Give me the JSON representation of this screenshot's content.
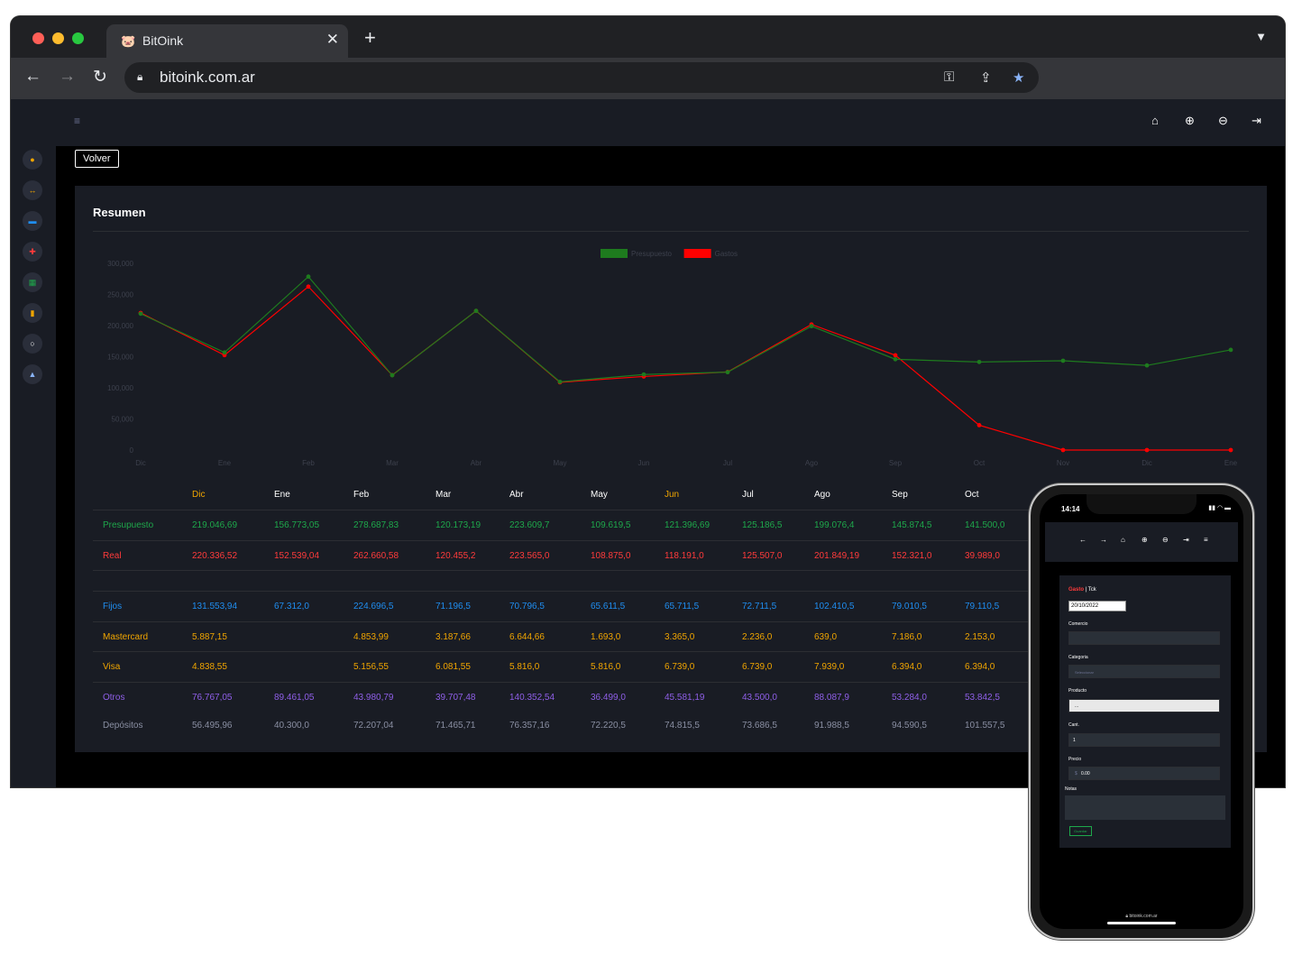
{
  "browser": {
    "tab_title": "BitOink",
    "url": "bitoink.com.ar"
  },
  "app": {
    "back_label": "Volver",
    "card_title": "Resumen"
  },
  "chart_data": {
    "type": "line",
    "categories": [
      "Dic",
      "Ene",
      "Feb",
      "Mar",
      "Abr",
      "May",
      "Jun",
      "Jul",
      "Ago",
      "Sep",
      "Oct",
      "Nov",
      "Dic",
      "Ene"
    ],
    "series": [
      {
        "name": "Presupuesto",
        "color": "#1e7b1e",
        "values": [
          219046.69,
          156773.05,
          278687.83,
          120173.19,
          223609.7,
          109619.5,
          121396.69,
          125186.5,
          199076.4,
          145874.5,
          141500,
          143500,
          136000,
          161000
        ]
      },
      {
        "name": "Gastos",
        "color": "#ff0000",
        "values": [
          220336.52,
          152539.04,
          262660.58,
          120455.2,
          223565,
          108875,
          118191,
          125507,
          201849.19,
          152321,
          39989,
          0,
          0,
          0
        ]
      }
    ],
    "yticks": [
      "300,000",
      "250,000",
      "200,000",
      "150,000",
      "100,000",
      "50,000",
      "0"
    ],
    "ylim": [
      0,
      300000
    ],
    "legend_position": "top-center"
  },
  "table": {
    "columns": [
      "Dic",
      "Ene",
      "Feb",
      "Mar",
      "Abr",
      "May",
      "Jun",
      "Jul",
      "Ago",
      "Sep",
      "Oct"
    ],
    "highlight_columns": [
      0,
      6
    ],
    "rows": [
      {
        "label": "Presupuesto",
        "color": "#1ea84b",
        "values": [
          "219.046,69",
          "156.773,05",
          "278.687,83",
          "120.173,19",
          "223.609,7",
          "109.619,5",
          "121.396,69",
          "125.186,5",
          "199.076,4",
          "145.874,5",
          "141.500,0"
        ]
      },
      {
        "label": "Real",
        "color": "#ff3b3b",
        "values": [
          "220.336,52",
          "152.539,04",
          "262.660,58",
          "120.455,2",
          "223.565,0",
          "108.875,0",
          "118.191,0",
          "125.507,0",
          "201.849,19",
          "152.321,0",
          "39.989,0"
        ]
      },
      {
        "label": "Fijos",
        "color": "#1f8ef1",
        "values": [
          "131.553,94",
          "67.312,0",
          "224.696,5",
          "71.196,5",
          "70.796,5",
          "65.611,5",
          "65.711,5",
          "72.711,5",
          "102.410,5",
          "79.010,5",
          "79.110,5"
        ]
      },
      {
        "label": "Mastercard",
        "color": "#f0a500",
        "values": [
          "5.887,15",
          "",
          "4.853,99",
          "3.187,66",
          "6.644,66",
          "1.693,0",
          "3.365,0",
          "2.236,0",
          "639,0",
          "7.186,0",
          "2.153,0"
        ]
      },
      {
        "label": "Visa",
        "color": "#f0a500",
        "values": [
          "4.838,55",
          "",
          "5.156,55",
          "6.081,55",
          "5.816,0",
          "5.816,0",
          "6.739,0",
          "6.739,0",
          "7.939,0",
          "6.394,0",
          "6.394,0"
        ]
      },
      {
        "label": "Otros",
        "color": "#8f5fe8",
        "values": [
          "76.767,05",
          "89.461,05",
          "43.980,79",
          "39.707,48",
          "140.352,54",
          "36.499,0",
          "45.581,19",
          "43.500,0",
          "88.087,9",
          "53.284,0",
          "53.842,5"
        ]
      },
      {
        "label": "Depósitos",
        "color": "#8a8fa3",
        "values": [
          "56.495,96",
          "40.300,0",
          "72.207,04",
          "71.465,71",
          "76.357,16",
          "72.220,5",
          "74.815,5",
          "73.686,5",
          "91.988,5",
          "94.590,5",
          "101.557,5"
        ]
      }
    ]
  },
  "phone": {
    "time": "14:14",
    "form_title_a": "Gasto",
    "form_title_b": "| Tck",
    "date_value": "20/10/2022",
    "label_comercio": "Comercio",
    "label_categoria": "Categoria",
    "categoria_placeholder": "Seleccionar",
    "label_producto": "Producto",
    "producto_value": "...",
    "label_cant": "Cant.",
    "cant_value": "1",
    "label_precio": "Precio",
    "precio_prefix": "$",
    "precio_value": "0.00",
    "label_notas": "Notas",
    "save_label": "Guardar",
    "url": "bitoink.com.ar"
  }
}
